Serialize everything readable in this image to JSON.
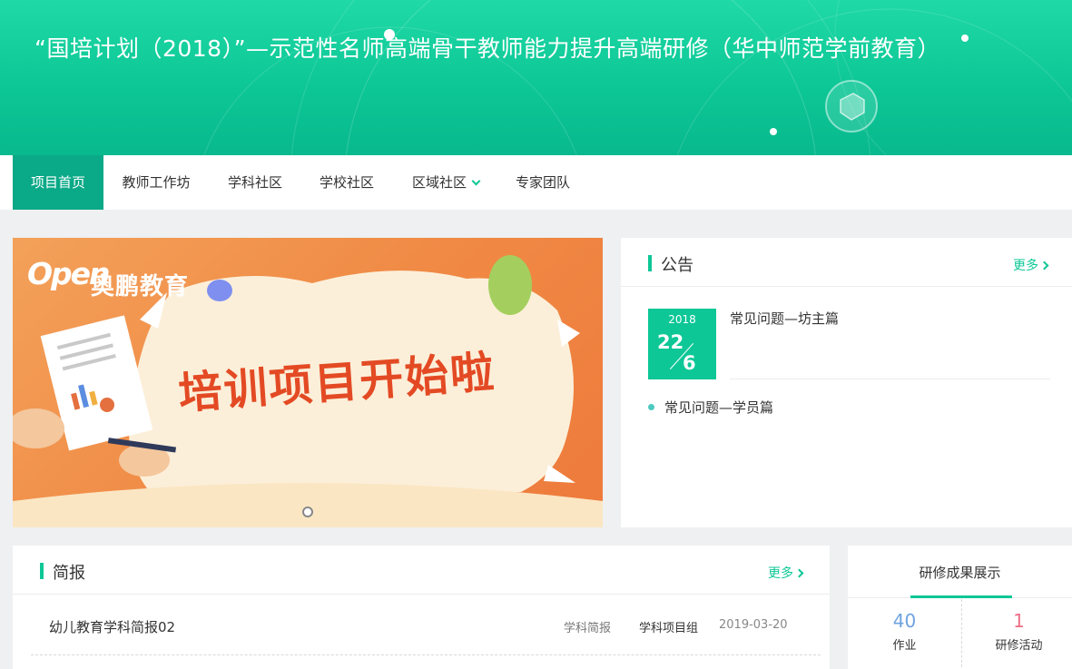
{
  "header": {
    "title": "“国培计划（2018）”—示范性名师高端骨干教师能力提升高端研修（华中师范学前教育）"
  },
  "nav": {
    "items": [
      {
        "label": "项目首页",
        "active": true
      },
      {
        "label": "教师工作坊"
      },
      {
        "label": "学科社区"
      },
      {
        "label": "学校社区"
      },
      {
        "label": "区域社区",
        "has_dropdown": true
      },
      {
        "label": "专家团队"
      }
    ]
  },
  "carousel": {
    "logo_mark": "Open",
    "logo_text": "奥鹏教育",
    "headline": "培训项目开始啦",
    "slide_count": 1
  },
  "notice": {
    "title": "公告",
    "more": "更多",
    "date": {
      "year": "2018",
      "day": "22",
      "month": "6"
    },
    "items": [
      "常见问题—坊主篇",
      "常见问题—学员篇"
    ]
  },
  "briefing": {
    "title": "简报",
    "more": "更多",
    "rows": [
      {
        "name": "幼儿教育学科简报02",
        "category": "学科简报",
        "group": "学科项目组",
        "date": "2019-03-20"
      }
    ]
  },
  "results": {
    "title": "研修成果展示",
    "stats": [
      {
        "value": "40",
        "label": "作业",
        "color": "#6fa3e0"
      },
      {
        "value": "1",
        "label": "研修活动",
        "color": "#ee6e86"
      }
    ]
  },
  "colors": {
    "brand": "#0dc796",
    "nav_active": "#0aa987",
    "headline": "#e34a24"
  }
}
